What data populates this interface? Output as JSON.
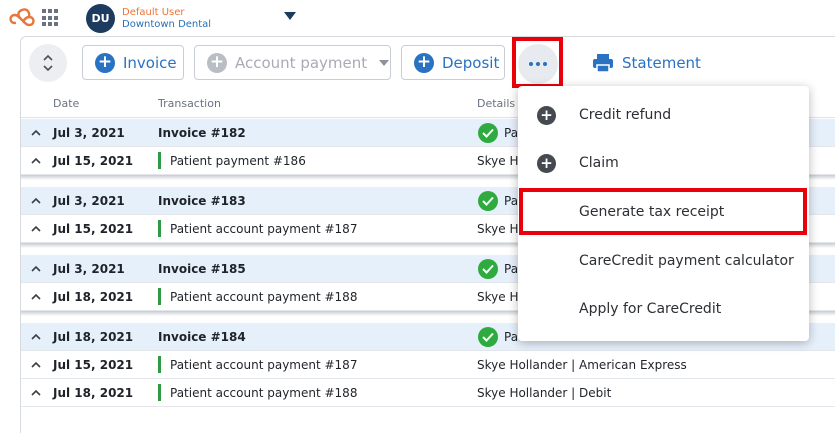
{
  "user": {
    "initials": "DU",
    "name": "Default User",
    "organization": "Downtown Dental"
  },
  "toolbar": {
    "invoice_label": "Invoice",
    "account_payment_label": "Account payment",
    "deposit_label": "Deposit",
    "statement_label": "Statement"
  },
  "table": {
    "columns": [
      "Date",
      "Transaction",
      "Details"
    ]
  },
  "groups": [
    {
      "invoice": {
        "date": "Jul 3, 2021",
        "transaction": "Invoice #182",
        "details": "Pa"
      },
      "payments": [
        {
          "date": "Jul 15, 2021",
          "transaction": "Patient payment #186",
          "details": "Skye Ho"
        }
      ]
    },
    {
      "invoice": {
        "date": "Jul 3, 2021",
        "transaction": "Invoice #183",
        "details": "Pa"
      },
      "payments": [
        {
          "date": "Jul 15, 2021",
          "transaction": "Patient account payment #187",
          "details": "Skye Ho"
        }
      ]
    },
    {
      "invoice": {
        "date": "Jul 3, 2021",
        "transaction": "Invoice #185",
        "details": "Pa"
      },
      "payments": [
        {
          "date": "Jul 18, 2021",
          "transaction": "Patient account payment #188",
          "details": "Skye Ho"
        }
      ]
    },
    {
      "invoice": {
        "date": "Jul 18, 2021",
        "transaction": "Invoice #184",
        "details": "Pa"
      },
      "payments": [
        {
          "date": "Jul 15, 2021",
          "transaction": "Patient account payment #187",
          "details": "Skye Hollander | American Express"
        },
        {
          "date": "Jul 18, 2021",
          "transaction": "Patient account payment #188",
          "details": "Skye Hollander | Debit"
        }
      ]
    }
  ],
  "menu": {
    "items": [
      {
        "label": "Credit refund",
        "icon": "plus-circle-icon"
      },
      {
        "label": "Claim",
        "icon": "plus-circle-icon"
      },
      {
        "label": "Generate tax receipt"
      },
      {
        "label": "CareCredit payment calculator"
      },
      {
        "label": "Apply for CareCredit"
      }
    ]
  },
  "colors": {
    "accent": "#2a72c2",
    "highlight": "#e8000b",
    "invoice_row": "#e6f0fb",
    "paid": "#2eaa3f"
  }
}
